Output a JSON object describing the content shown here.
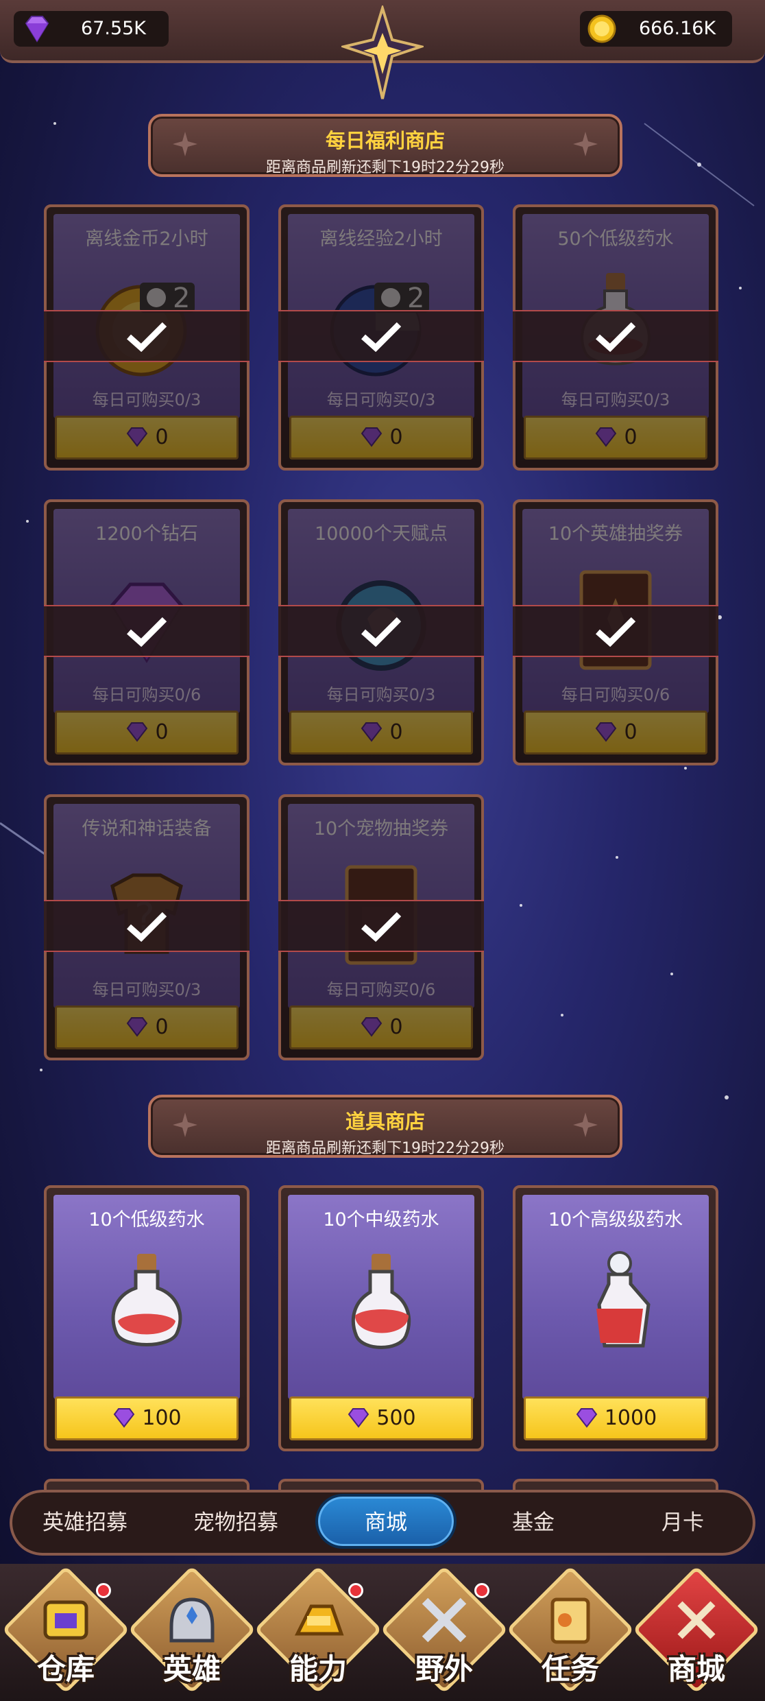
{
  "resources": {
    "gems": "67.55K",
    "gold": "666.16K"
  },
  "daily_shop": {
    "title": "每日福利商店",
    "subtitle": "距离商品刷新还剩下19时22分29秒",
    "items": [
      {
        "name": "离线金币2小时",
        "limit": "每日可购买0/3",
        "price": "0",
        "icon": "gold-coin-clock-icon",
        "badge": "2"
      },
      {
        "name": "离线经验2小时",
        "limit": "每日可购买0/3",
        "price": "0",
        "icon": "exp-orb-clock-icon",
        "badge": "2"
      },
      {
        "name": "50个低级药水",
        "limit": "每日可购买0/3",
        "price": "0",
        "icon": "potion-bottle-icon"
      },
      {
        "name": "1200个钻石",
        "limit": "每日可购买0/6",
        "price": "0",
        "icon": "diamond-icon"
      },
      {
        "name": "10000个天赋点",
        "limit": "每日可购买0/3",
        "price": "0",
        "icon": "talent-orb-icon"
      },
      {
        "name": "10个英雄抽奖券",
        "limit": "每日可购买0/6",
        "price": "0",
        "icon": "hero-ticket-icon"
      },
      {
        "name": "传说和神话装备",
        "limit": "每日可购买0/3",
        "price": "0",
        "icon": "mystery-equipment-icon"
      },
      {
        "name": "10个宠物抽奖券",
        "limit": "每日可购买0/6",
        "price": "0",
        "icon": "pet-ticket-icon"
      }
    ]
  },
  "item_shop": {
    "title": "道具商店",
    "subtitle": "距离商品刷新还剩下19时22分29秒",
    "items": [
      {
        "name": "10个低级药水",
        "price": "100",
        "icon": "low-potion-icon"
      },
      {
        "name": "10个中级药水",
        "price": "500",
        "icon": "mid-potion-icon"
      },
      {
        "name": "10个高级级药水",
        "price": "1000",
        "icon": "high-potion-icon"
      }
    ]
  },
  "tabs": [
    {
      "label": "英雄招募",
      "active": false
    },
    {
      "label": "宠物招募",
      "active": false
    },
    {
      "label": "商城",
      "active": true
    },
    {
      "label": "基金",
      "active": false
    },
    {
      "label": "月卡",
      "active": false
    }
  ],
  "nav": [
    {
      "label": "仓库",
      "icon": "warehouse-icon",
      "dot": true
    },
    {
      "label": "英雄",
      "icon": "hero-helmet-icon",
      "dot": false
    },
    {
      "label": "能力",
      "icon": "ability-gold-icon",
      "dot": true
    },
    {
      "label": "野外",
      "icon": "crossed-swords-icon",
      "dot": true
    },
    {
      "label": "任务",
      "icon": "quest-scroll-icon",
      "dot": false
    },
    {
      "label": "商城",
      "icon": "shop-icon",
      "dot": false,
      "active": true
    }
  ],
  "colors": {
    "accent_gold": "#ffd23f",
    "tab_active": "#1a5fa8",
    "nav_active": "#e24444"
  }
}
